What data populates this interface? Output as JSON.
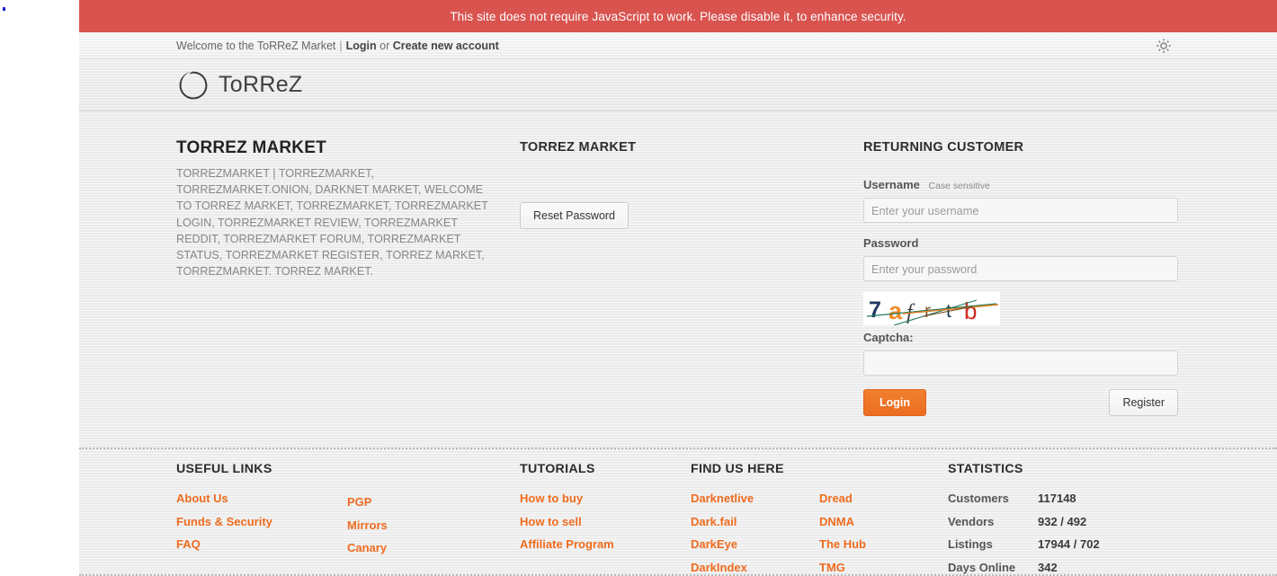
{
  "notice": {
    "text": "This site does not require JavaScript to work. Please disable it, to enhance security."
  },
  "welcome": {
    "greeting": "Welcome to the ToRReZ Market",
    "separator": "|",
    "login_label": "Login",
    "or_label": "or",
    "create_account_label": "Create new account",
    "theme_icon": "sun-icon"
  },
  "brand": {
    "logo_icon": "circle-ring-logo",
    "name": "ToRReZ"
  },
  "left_column": {
    "title": "TORREZ MARKET",
    "keywords": "TORREZMARKET | TORREZMARKET, TORREZMARKET.ONION, DARKNET MARKET, WELCOME TO TORREZ MARKET, TORREZMARKET, TORREZMARKET LOGIN, TORREZMARKET REVIEW, TORREZMARKET REDDIT, TORREZMARKET FORUM, TORREZMARKET STATUS, TORREZMARKET REGISTER, TORREZ MARKET, TORREZMARKET. TORREZ MARKET."
  },
  "middle_column": {
    "title": "TORREZ MARKET",
    "reset_password_label": "Reset Password"
  },
  "login_form": {
    "title": "RETURNING CUSTOMER",
    "username_label": "Username",
    "username_hint": "Case sensitive",
    "username_placeholder": "Enter your username",
    "username_value": "",
    "password_label": "Password",
    "password_placeholder": "Enter your password",
    "password_value": "",
    "captcha_text": "7afrtb",
    "captcha_chars": [
      "7",
      "a",
      "f",
      "r",
      "t",
      "b"
    ],
    "captcha_colors": [
      "#1f3864",
      "#f28c28",
      "#3f3f46",
      "#8a5a2b",
      "#1f3b4d",
      "#cf2a20"
    ],
    "captcha_label": "Captcha:",
    "captcha_placeholder": "",
    "captcha_value": "",
    "login_label": "Login",
    "register_label": "Register"
  },
  "footer": {
    "useful_links": {
      "heading": "USEFUL LINKS",
      "col_a": [
        "About Us",
        "Funds & Security",
        "FAQ"
      ],
      "col_b": [
        "PGP",
        "Mirrors",
        "Canary"
      ]
    },
    "tutorials": {
      "heading": "TUTORIALS",
      "items": [
        "How to buy",
        "How to sell",
        "Affiliate Program"
      ]
    },
    "find_us": {
      "heading": "FIND US HERE",
      "col_a": [
        "Darknetlive",
        "Dark.fail",
        "DarkEye",
        "DarkIndex"
      ],
      "col_b": [
        "Dread",
        "DNMA",
        "The Hub",
        "TMG"
      ]
    },
    "statistics": {
      "heading": "STATISTICS",
      "rows": [
        {
          "key": "Customers",
          "value": "117148"
        },
        {
          "key": "Vendors",
          "value": "932 / 492"
        },
        {
          "key": "Listings",
          "value": "17944 / 702"
        },
        {
          "key": "Days Online",
          "value": "342"
        }
      ]
    }
  },
  "colors": {
    "notice_bg": "#d9534f",
    "accent": "#ef6c1f",
    "page_bg": "#eeeeee"
  }
}
